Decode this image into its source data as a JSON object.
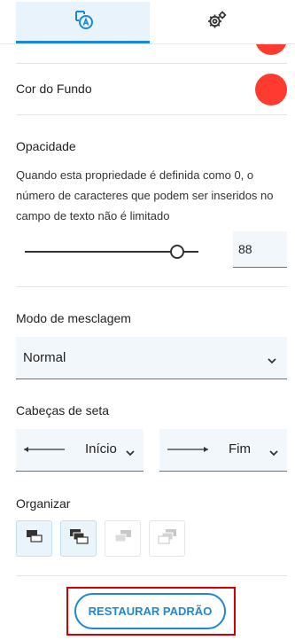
{
  "tabs": [
    {
      "icon": "text-style-icon",
      "active": true
    },
    {
      "icon": "gear-icon",
      "active": false
    }
  ],
  "colors": {
    "accent": "#1e88d8",
    "swatch": "#ff3b30",
    "active_tab_bg": "#e8f3fb",
    "input_bg": "#f2f7fc",
    "highlight_border": "#d40000"
  },
  "background_color": {
    "label": "Cor do Fundo",
    "swatch_color": "#ff3b30"
  },
  "opacity": {
    "label": "Opacidade",
    "description": "Quando esta propriedade é definida como 0, o número de caracteres que podem ser inseridos no campo de texto não é limitado",
    "value": "88",
    "slider_fraction": 0.88
  },
  "blend_mode": {
    "label": "Modo de mesclagem",
    "selected": "Normal"
  },
  "arrowheads": {
    "label": "Cabeças de seta",
    "start": "Início",
    "end": "Fim"
  },
  "arrange": {
    "label": "Organizar",
    "buttons": [
      {
        "icon": "bring-forward-icon",
        "enabled": true
      },
      {
        "icon": "bring-to-front-icon",
        "enabled": true
      },
      {
        "icon": "send-backward-icon",
        "enabled": false
      },
      {
        "icon": "send-to-back-icon",
        "enabled": false
      }
    ]
  },
  "restore_button": {
    "label": "RESTAURAR PADRÃO"
  }
}
